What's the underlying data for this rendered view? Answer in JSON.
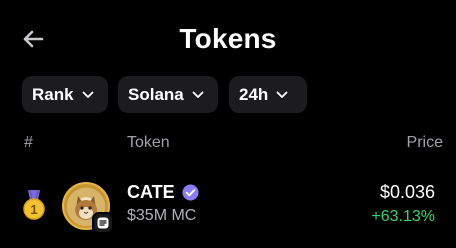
{
  "header": {
    "title": "Tokens",
    "back_icon": "arrow-left-icon"
  },
  "filters": [
    {
      "label": "Rank"
    },
    {
      "label": "Solana"
    },
    {
      "label": "24h"
    }
  ],
  "columns": {
    "rank": "#",
    "token": "Token",
    "price": "Price"
  },
  "tokens": [
    {
      "rank": "1",
      "symbol": "CATE",
      "market_cap": "$35M MC",
      "price": "$0.036",
      "change": "+63.13%",
      "verified": true
    }
  ],
  "colors": {
    "background": "#000000",
    "chip": "#1c1c1e",
    "positive": "#35d46a",
    "verified": "#8b7cf6",
    "medal_gold": "#f2c230",
    "muted": "#a0a0a8"
  }
}
